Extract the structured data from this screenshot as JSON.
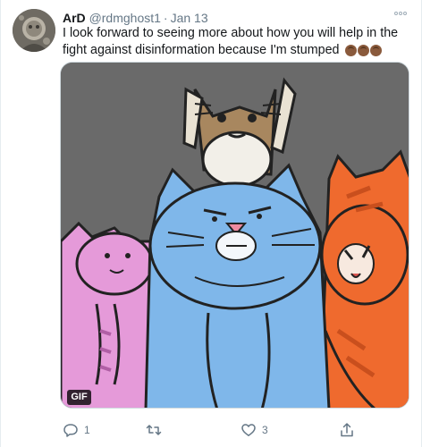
{
  "tweet": {
    "display_name": "ArD",
    "handle": "@rdmghost1",
    "separator": "·",
    "date": "Jan 13",
    "more_icon": "ellipsis-icon",
    "text": "I look forward to seeing more about how you will help in the fight against disinformation because I'm stumped",
    "emoji": "face-palm-emoji",
    "media": {
      "type": "gif",
      "badge": "GIF",
      "background_color": "#6a6a6a"
    },
    "actions": {
      "reply": {
        "icon": "reply-icon",
        "count": "1"
      },
      "retweet": {
        "icon": "retweet-icon",
        "count": ""
      },
      "like": {
        "icon": "heart-icon",
        "count": "3"
      },
      "share": {
        "icon": "share-icon",
        "count": ""
      }
    }
  },
  "colors": {
    "text": "#14171a",
    "muted": "#657786",
    "border": "#e6ecf0"
  }
}
